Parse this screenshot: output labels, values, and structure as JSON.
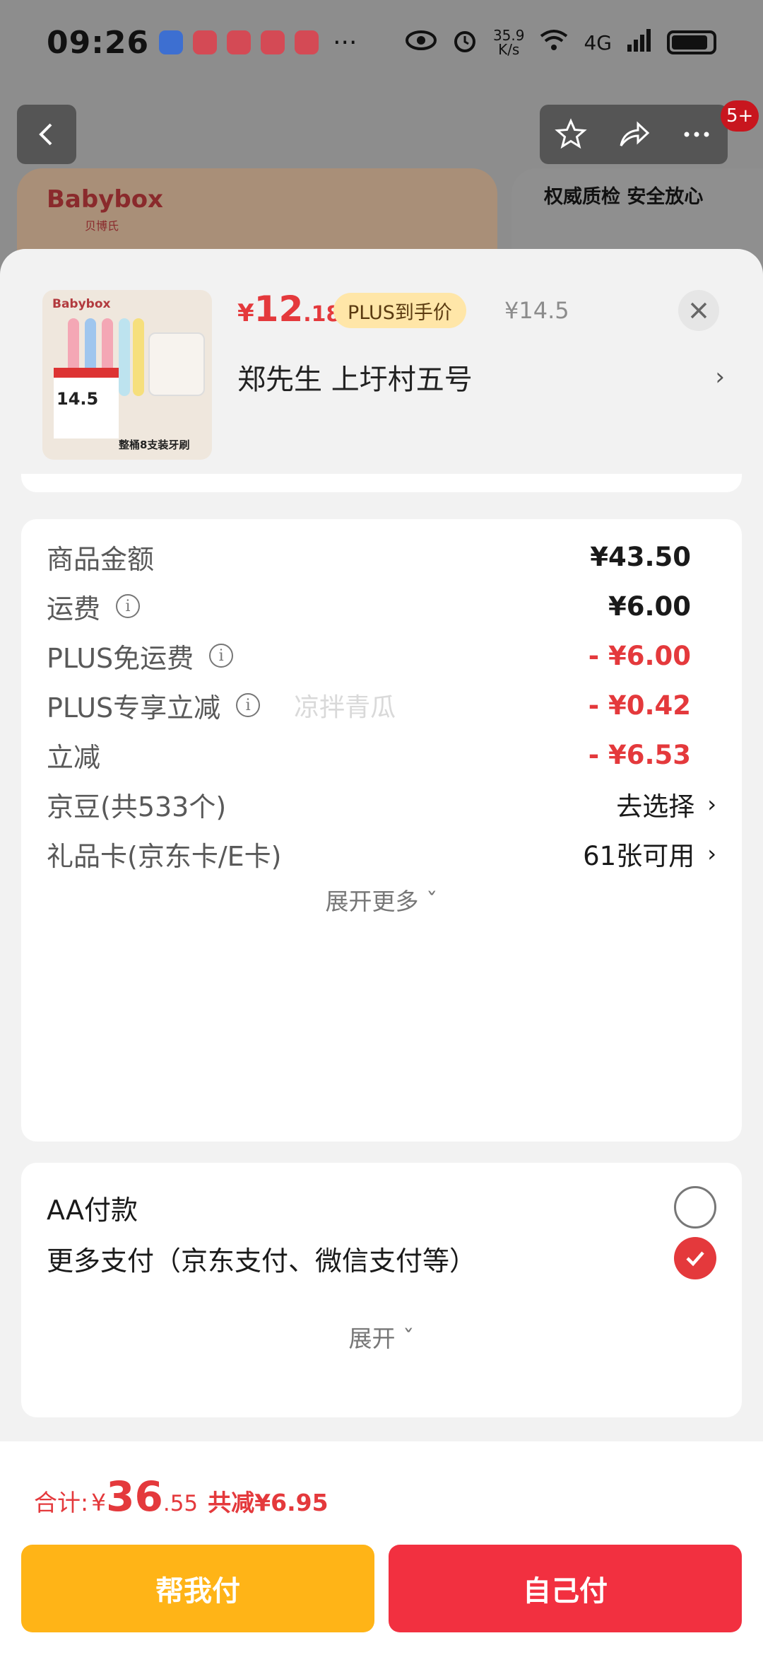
{
  "status_bar": {
    "time": "09:26",
    "more": "···",
    "speed_value": "35.9",
    "speed_unit": "K/s",
    "network": "4G"
  },
  "background": {
    "badge": "5+",
    "brand": "Babybox",
    "brand_sub": "贝博氏",
    "side_title": "权威质检 安全放心"
  },
  "product": {
    "thumb_brand": "Babybox",
    "thumb_price": "14.5",
    "thumb_caption": "整桶8支装牙刷",
    "price_symbol": "¥",
    "price_int": "12",
    "price_dec": ".18",
    "plus_tag": "PLUS到手价",
    "original_price": "¥14.5",
    "address": "郑先生  上圩村五号"
  },
  "costs": {
    "rows": [
      {
        "label": "商品金额",
        "value": "¥43.50"
      },
      {
        "label": "运费",
        "value": "¥6.00"
      },
      {
        "label": "PLUS免运费",
        "value": "- ¥6.00"
      },
      {
        "label": "PLUS专享立减",
        "value": "- ¥0.42",
        "watermark": "凉拌青瓜"
      },
      {
        "label": "立减",
        "value": "- ¥6.53"
      },
      {
        "label": "京豆(共533个)",
        "value": "去选择"
      },
      {
        "label": "礼品卡(京东卡/E卡)",
        "value": "61张可用"
      }
    ],
    "expand_more": "展开更多 ˇ"
  },
  "payment": {
    "aa_label": "AA付款",
    "more_label": "更多支付（京东支付、微信支付等）",
    "expand": "展开 ˇ"
  },
  "bottom": {
    "total_label": "合计:",
    "total_symbol": "¥",
    "total_int": "36",
    "total_dec": ".55",
    "total_saved": "共减¥6.95",
    "btn_help": "帮我付",
    "btn_self": "自己付"
  },
  "colors": {
    "accent_red": "#e4393c",
    "button_yellow": "#ffb417",
    "button_red": "#f23040",
    "plus_tag_bg": "#ffe6a8"
  },
  "icons": [
    "back-icon",
    "star-icon",
    "share-icon",
    "more-icon",
    "close-icon",
    "info-icon",
    "chevron-right-icon",
    "check-icon"
  ]
}
